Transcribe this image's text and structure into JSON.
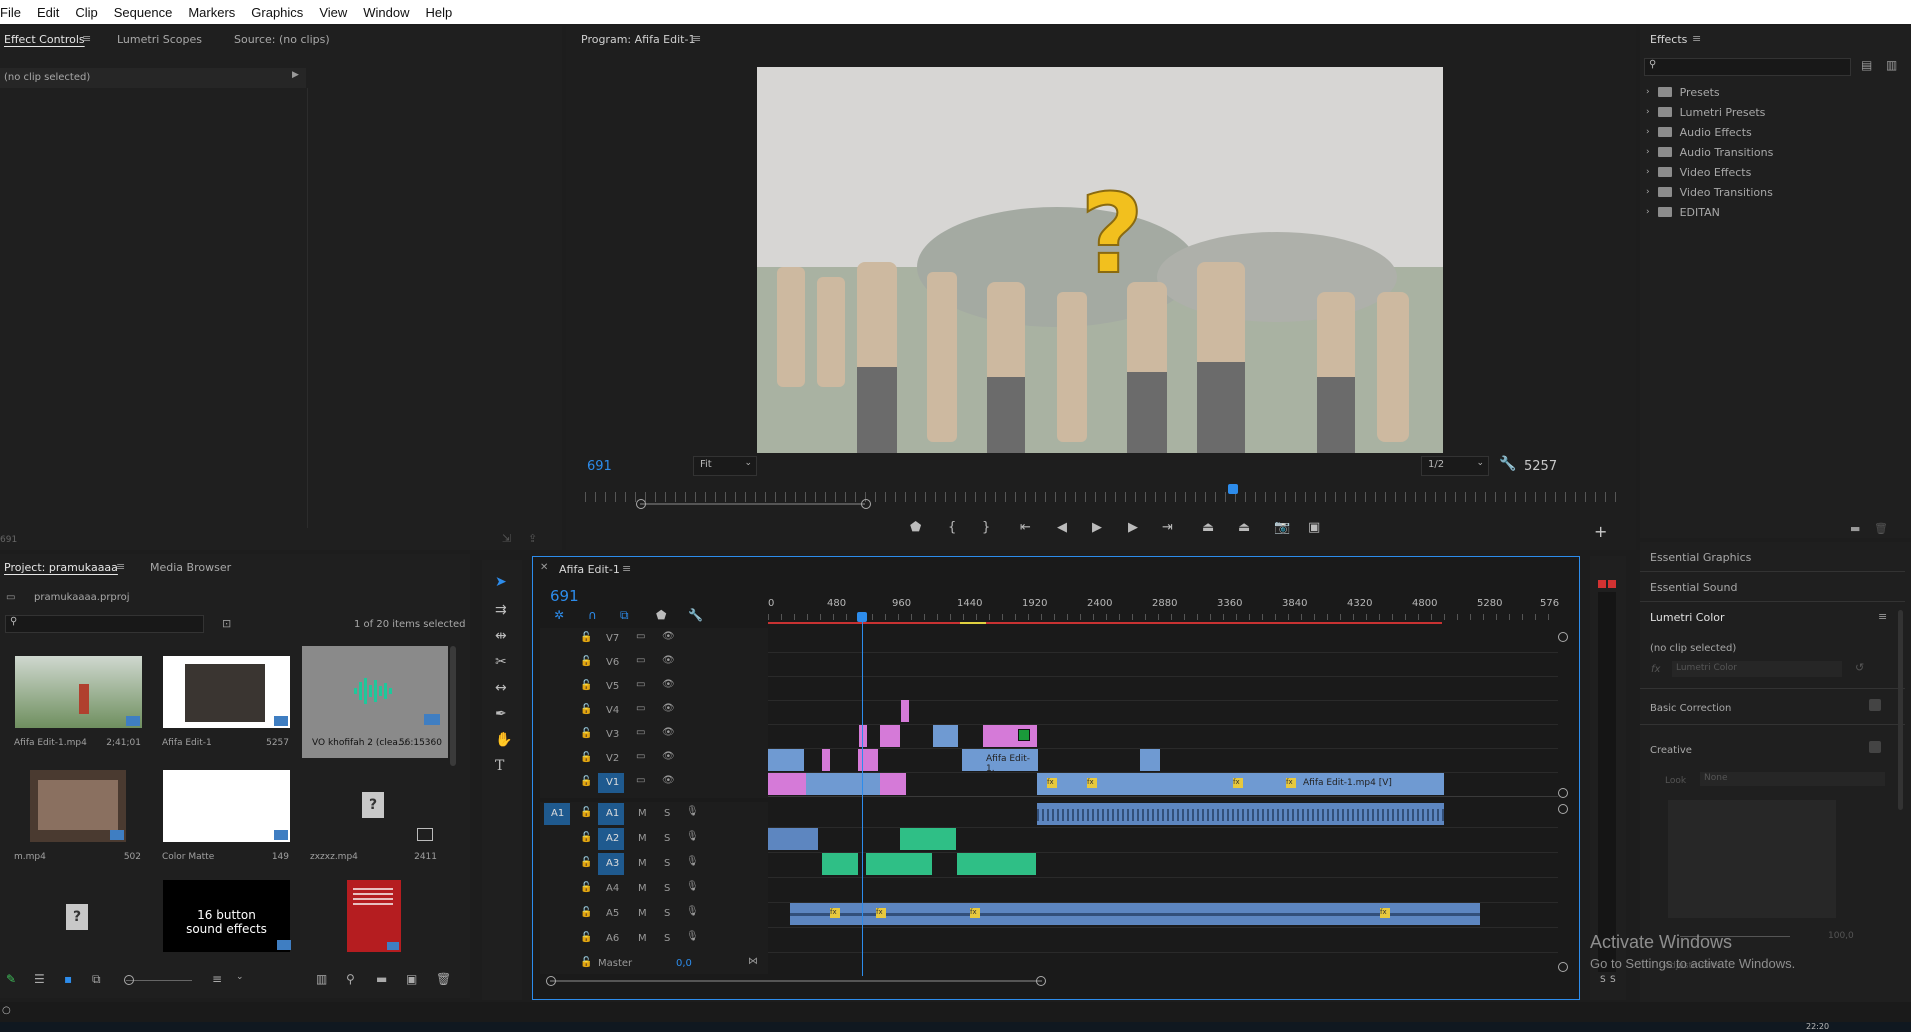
{
  "menu": [
    "File",
    "Edit",
    "Clip",
    "Sequence",
    "Markers",
    "Graphics",
    "View",
    "Window",
    "Help"
  ],
  "effect_controls": {
    "tabs": [
      "Effect Controls",
      "Lumetri Scopes",
      "Source: (no clips)"
    ],
    "status": "(no clip selected)",
    "bottom_time": "691"
  },
  "program": {
    "title": "Program: Afifa Edit-1",
    "timecode": "691",
    "fit": "Fit",
    "resolution": "1/2",
    "duration": "5257"
  },
  "effects": {
    "title": "Effects",
    "items": [
      "Presets",
      "Lumetri Presets",
      "Audio Effects",
      "Audio Transitions",
      "Video Effects",
      "Video Transitions",
      "EDITAN"
    ]
  },
  "right_lower": {
    "items": [
      "Essential Graphics",
      "Essential Sound",
      "Lumetri Color"
    ],
    "status": "(no clip selected)",
    "fx_label": "fx",
    "fx_value": "Lumetri Color",
    "sections": [
      "Basic Correction",
      "Creative"
    ],
    "look_label": "Look",
    "look_value": "None",
    "slider_value": "100,0",
    "adjustments": "Adjustments"
  },
  "project": {
    "tabs": [
      "Project: pramukaaaa",
      "Media Browser"
    ],
    "file": "pramukaaaa.prproj",
    "selection": "1 of 20 items selected",
    "items": [
      {
        "name": "Afifa Edit-1.mp4",
        "dur": "2;41;01"
      },
      {
        "name": "Afifa Edit-1",
        "dur": "5257"
      },
      {
        "name": "VO khofifah 2 (clea...",
        "dur": "56:15360"
      },
      {
        "name": "m.mp4",
        "dur": "502"
      },
      {
        "name": "Color Matte",
        "dur": "149"
      },
      {
        "name": "zxzxz.mp4",
        "dur": "2411"
      },
      {
        "name": "",
        "dur": ""
      },
      {
        "name": "",
        "dur": ""
      },
      {
        "name": "",
        "dur": ""
      }
    ],
    "button_thumb_text": "16 button\nsound effects"
  },
  "timeline": {
    "title": "Afifa Edit-1",
    "timecode": "691",
    "ruler": [
      "0",
      "480",
      "960",
      "1440",
      "1920",
      "2400",
      "2880",
      "3360",
      "3840",
      "4320",
      "4800",
      "5280",
      "576"
    ],
    "video_tracks": [
      "V7",
      "V6",
      "V5",
      "V4",
      "V3",
      "V2",
      "V1"
    ],
    "audio_tracks": [
      "A1",
      "A2",
      "A3",
      "A4",
      "A5",
      "A6"
    ],
    "src_video": "",
    "src_audio": "A1",
    "master_label": "Master",
    "master_value": "0,0",
    "clip_label_v1": "Afifa Edit-1.mp4 [V]",
    "clip_label_v2": "Afifa Edit-1."
  },
  "meters": {
    "labels": [
      "S",
      "S"
    ]
  },
  "watermark": {
    "title": "Activate Windows",
    "sub": "Go to Settings to activate Windows."
  },
  "taskbar": {
    "time": "22:20"
  }
}
